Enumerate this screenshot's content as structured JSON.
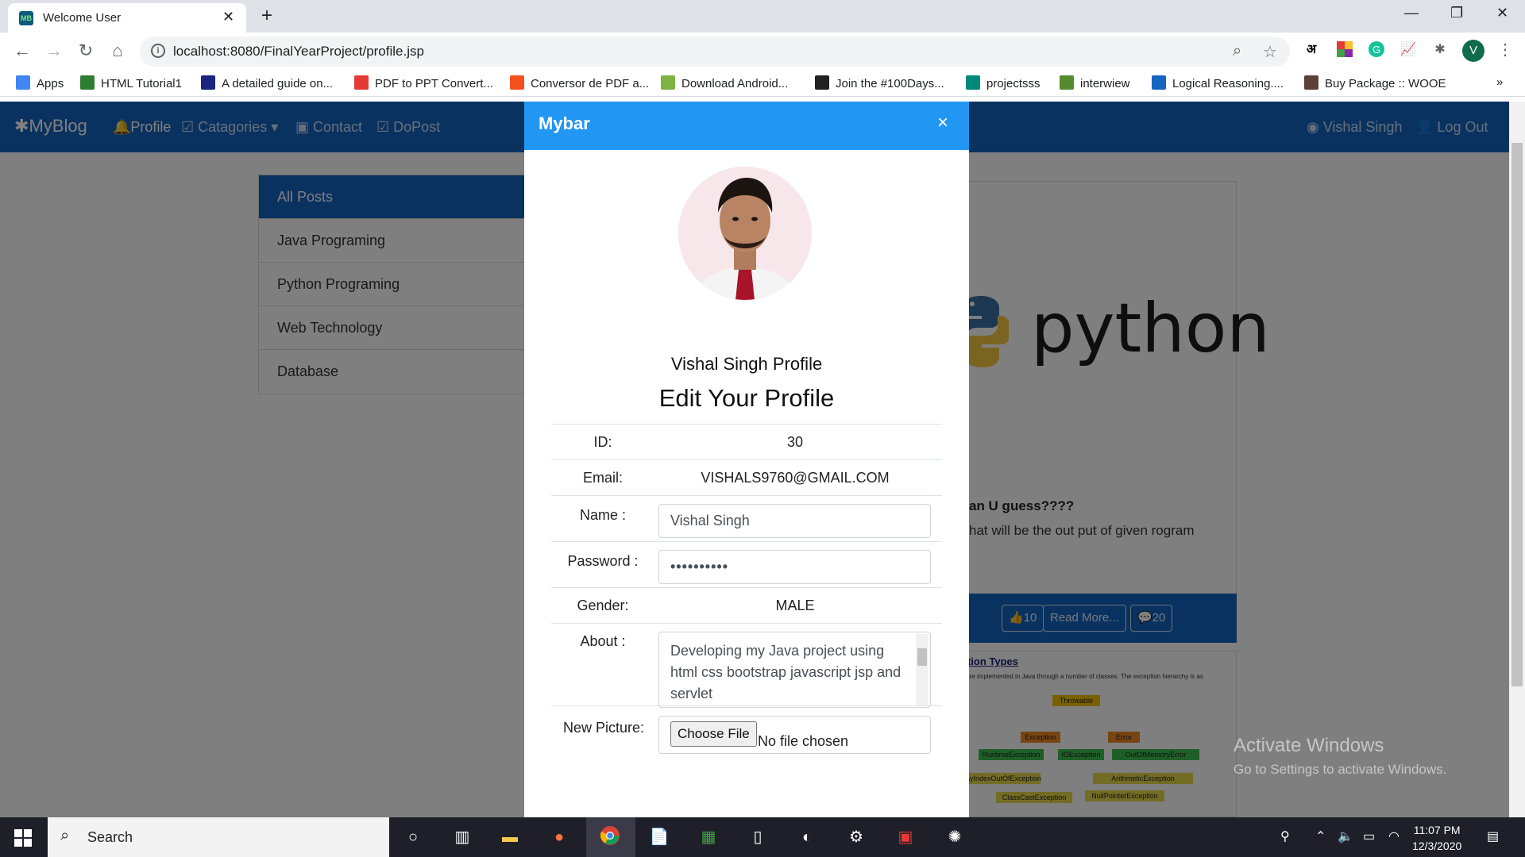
{
  "browser": {
    "tab_title": "Welcome User",
    "favicon_text": "MB",
    "url": "localhost:8080/FinalYearProject/profile.jsp",
    "bookmarks": [
      {
        "label": "Apps",
        "color": "#4285f4"
      },
      {
        "label": "HTML Tutorial1",
        "color": "#2e7d32"
      },
      {
        "label": "A detailed guide on...",
        "color": "#1a237e"
      },
      {
        "label": "PDF to PPT Convert...",
        "color": "#e53935"
      },
      {
        "label": "Conversor de PDF a...",
        "color": "#f4511e"
      },
      {
        "label": "Download Android...",
        "color": "#7cb342"
      },
      {
        "label": "Join the #100Days...",
        "color": "#222222"
      },
      {
        "label": "projectsss",
        "color": "#00897b"
      },
      {
        "label": "interwiew",
        "color": "#558b2f"
      },
      {
        "label": "Logical Reasoning....",
        "color": "#1565c0"
      },
      {
        "label": "Buy Package :: WOOE",
        "color": "#5d4037"
      }
    ],
    "avatar_letter": "V",
    "lang_icon": "अ"
  },
  "site": {
    "brand": "MyBlog",
    "nav": [
      "Profile",
      "Catagories",
      "Contact",
      "DoPost"
    ],
    "user": "Vishal Singh",
    "logout": "Log Out",
    "categories": [
      "All Posts",
      "Java Programing",
      "Python Programing",
      "Web Technology",
      "Database"
    ],
    "post": {
      "image_word": "python",
      "title_fragment": "an U guess????",
      "text_fragment": "hat will be the out put of given rogram",
      "likes": "10",
      "read_more": "Read More...",
      "comments": "20"
    },
    "diagram": {
      "title": "ption Types",
      "subtitle": "s are implemented in Java through a number of classes. The exception hierarchy is as",
      "nodes": [
        "Throwable",
        "Exception",
        "Error",
        "RuntimeException",
        "IOException",
        "OutOfMemoryError",
        "rrayIndexOutOfException",
        "ArithmeticException",
        "ClassCastException",
        "NullPointerException"
      ]
    }
  },
  "modal": {
    "title": "Mybar",
    "close": "×",
    "profile_heading": "Vishal Singh Profile",
    "edit_heading": "Edit Your Profile",
    "id_label": "ID:",
    "id_value": "30",
    "email_label": "Email:",
    "email_value": "VISHALS9760@GMAIL.COM",
    "name_label": "Name :",
    "name_value": "Vishal Singh",
    "password_label": "Password :",
    "password_value": "••••••••••",
    "gender_label": "Gender:",
    "gender_value": "MALE",
    "about_label": "About :",
    "about_value": "Developing my Java project using html css bootstrap javascript jsp and servlet",
    "picture_label": "New Picture:",
    "file_button": "Choose File",
    "file_status": "No file chosen"
  },
  "windows": {
    "watermark_title": "Activate Windows",
    "watermark_sub": "Go to Settings to activate Windows.",
    "search": "Search",
    "time": "11:07 PM",
    "date": "12/3/2020"
  }
}
